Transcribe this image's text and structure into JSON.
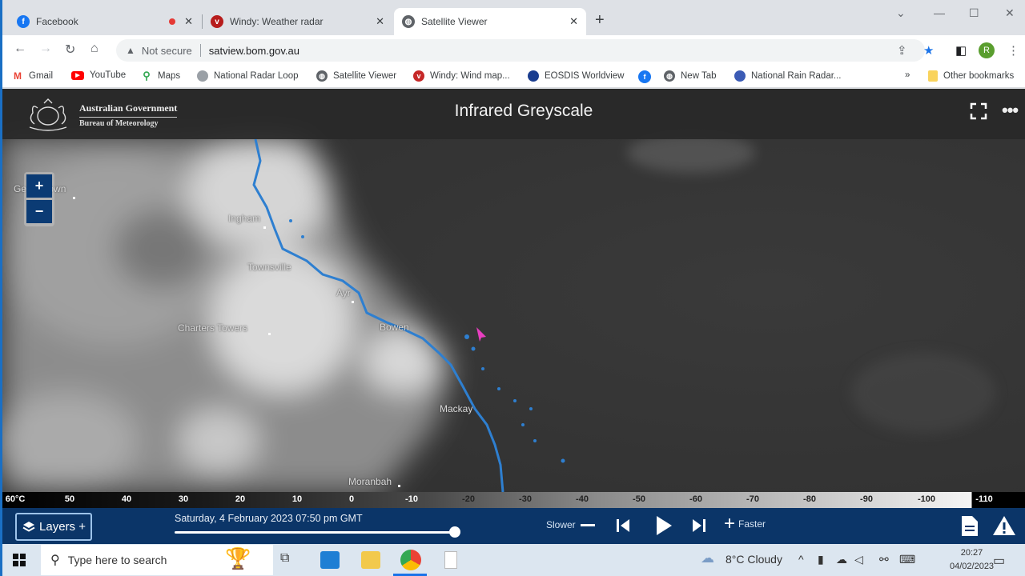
{
  "browser": {
    "tabs": [
      {
        "label": "Facebook",
        "icon": "facebook-icon",
        "active": false,
        "recording": true
      },
      {
        "label": "Windy: Weather radar",
        "icon": "windy-icon",
        "active": false
      },
      {
        "label": "Satellite Viewer",
        "icon": "globe-icon",
        "active": true
      }
    ],
    "new_tab_symbol": "+",
    "close_symbol": "✕",
    "window_controls": {
      "dropdown": "⌄",
      "minimize": "—",
      "maximize": "☐",
      "close": "✕"
    },
    "nav": {
      "back": "←",
      "forward": "→",
      "reload": "↻",
      "home": "⌂"
    },
    "address": {
      "security_label": "Not secure",
      "url": "satview.bom.gov.au"
    },
    "profile_initial": "R",
    "menu_symbol": "⋮",
    "bookmarks": [
      {
        "label": "Gmail",
        "icon": "gmail-icon",
        "color": "#ea4335"
      },
      {
        "label": "YouTube",
        "icon": "youtube-icon",
        "color": "#ff0000"
      },
      {
        "label": "Maps",
        "icon": "maps-pin-icon",
        "color": "#34a853"
      },
      {
        "label": "National Radar Loop",
        "icon": "radar-icon",
        "color": "#9aa0a6"
      },
      {
        "label": "Satellite Viewer",
        "icon": "globe-icon",
        "color": "#5f6368"
      },
      {
        "label": "Windy: Wind map...",
        "icon": "windy-icon",
        "color": "#c62828"
      },
      {
        "label": "EOSDIS Worldview",
        "icon": "nasa-icon",
        "color": "#1a3d8f"
      },
      {
        "label": "",
        "icon": "facebook-icon",
        "color": "#1877f2"
      },
      {
        "label": "New Tab",
        "icon": "globe-icon",
        "color": "#5f6368"
      },
      {
        "label": "National Rain Radar...",
        "icon": "radar-icon",
        "color": "#3b5bb5"
      }
    ],
    "overflow_symbol": "»",
    "other_bookmarks": "Other bookmarks"
  },
  "app": {
    "org_line1": "Australian Government",
    "org_line2": "Bureau of Meteorology",
    "title": "Infrared Greyscale",
    "more_symbol": "•••",
    "zoom_in": "+",
    "zoom_out": "−",
    "places": [
      {
        "name": "Georgetown"
      },
      {
        "name": "Ingham"
      },
      {
        "name": "Townsville"
      },
      {
        "name": "Ayr"
      },
      {
        "name": "Charters Towers"
      },
      {
        "name": "Bowen"
      },
      {
        "name": "Mackay"
      },
      {
        "name": "Moranbah"
      }
    ],
    "scale": {
      "unit": "°C",
      "ticks": [
        "60°C",
        "50",
        "40",
        "30",
        "20",
        "10",
        "0",
        "-10",
        "-20",
        "-30",
        "-40",
        "-50",
        "-60",
        "-70",
        "-80",
        "-90",
        "-100",
        "-110"
      ]
    },
    "controls": {
      "layers_label": "Layers +",
      "timestamp": "Saturday, 4 February 2023 07:50 pm GMT",
      "timeline_position": 1.0,
      "slower_label": "Slower",
      "faster_label": "Faster"
    }
  },
  "taskbar": {
    "search_placeholder": "Type here to search",
    "weather": "8°C  Cloudy",
    "time": "20:27",
    "date": "04/02/2023"
  }
}
